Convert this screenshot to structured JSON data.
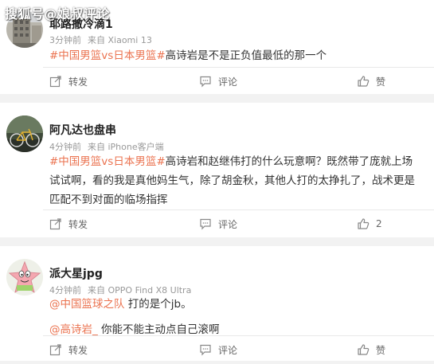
{
  "watermark": "搜狐号@娘叔评论",
  "comments": [
    {
      "username": "耶路撒冷滴1",
      "time": "3分钟前",
      "source": "来自 Xiaomi 13",
      "hashtag": "#中国男篮vs日本男篮#",
      "text": "高诗岩是不是正负值最低的那一个",
      "repost_label": "转发",
      "comment_label": "评论",
      "like_label": "赞"
    },
    {
      "username": "阿凡达也盘串",
      "time": "4分钟前",
      "source": "来自 iPhone客户端",
      "hashtag": "#中国男篮vs日本男篮#",
      "text": "高诗岩和赵继伟打的什么玩意啊？既然带了庞就上场试试啊，看的我是真他妈生气，除了胡金秋，其他人打的太挣扎了，战术更是匹配不到对面的临场指挥",
      "repost_label": "转发",
      "comment_label": "评论",
      "like_label": "2"
    },
    {
      "username": "派大星jpg",
      "time": "4分钟前",
      "source": "来自 OPPO Find X8 Ultra",
      "mention1": "@中国篮球之队",
      "line1": " 打的是个jb。",
      "mention2": "@高诗岩_",
      "line2": " 你能不能主动点自己滚啊",
      "repost_label": "转发",
      "comment_label": "评论",
      "like_label": "赞"
    }
  ],
  "colors": {
    "accent": "#eb7350",
    "meta": "#999999"
  }
}
